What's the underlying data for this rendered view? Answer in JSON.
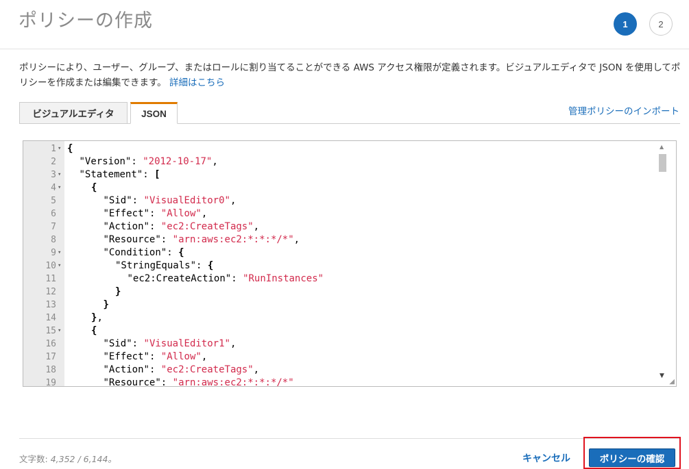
{
  "header": {
    "title": "ポリシーの作成",
    "steps": [
      "1",
      "2"
    ],
    "active_step": "1"
  },
  "description": {
    "text": "ポリシーにより、ユーザー、グループ、またはロールに割り当てることができる AWS アクセス権限が定義されます。ビジュアルエディタで JSON を使用してポリシーを作成または編集できます。",
    "link": "詳細はこちら"
  },
  "tabs": [
    {
      "label": "ビジュアルエディタ",
      "active": false
    },
    {
      "label": "JSON",
      "active": true
    }
  ],
  "import_link": "管理ポリシーのインポート",
  "editor": {
    "lines": [
      {
        "n": "1",
        "fold": true,
        "indent": 0,
        "parts": [
          [
            "p",
            "{"
          ]
        ]
      },
      {
        "n": "2",
        "fold": false,
        "indent": 1,
        "parts": [
          [
            "k",
            "\"Version\""
          ],
          [
            "k",
            ": "
          ],
          [
            "s",
            "\"2012-10-17\""
          ],
          [
            "k",
            ","
          ]
        ]
      },
      {
        "n": "3",
        "fold": true,
        "indent": 1,
        "parts": [
          [
            "k",
            "\"Statement\""
          ],
          [
            "k",
            ": "
          ],
          [
            "p",
            "["
          ]
        ]
      },
      {
        "n": "4",
        "fold": true,
        "indent": 2,
        "parts": [
          [
            "p",
            "{"
          ]
        ]
      },
      {
        "n": "5",
        "fold": false,
        "indent": 3,
        "parts": [
          [
            "k",
            "\"Sid\""
          ],
          [
            "k",
            ": "
          ],
          [
            "s",
            "\"VisualEditor0\""
          ],
          [
            "k",
            ","
          ]
        ]
      },
      {
        "n": "6",
        "fold": false,
        "indent": 3,
        "parts": [
          [
            "k",
            "\"Effect\""
          ],
          [
            "k",
            ": "
          ],
          [
            "s",
            "\"Allow\""
          ],
          [
            "k",
            ","
          ]
        ]
      },
      {
        "n": "7",
        "fold": false,
        "indent": 3,
        "parts": [
          [
            "k",
            "\"Action\""
          ],
          [
            "k",
            ": "
          ],
          [
            "s",
            "\"ec2:CreateTags\""
          ],
          [
            "k",
            ","
          ]
        ]
      },
      {
        "n": "8",
        "fold": false,
        "indent": 3,
        "parts": [
          [
            "k",
            "\"Resource\""
          ],
          [
            "k",
            ": "
          ],
          [
            "s",
            "\"arn:aws:ec2:*:*:*/*\""
          ],
          [
            "k",
            ","
          ]
        ]
      },
      {
        "n": "9",
        "fold": true,
        "indent": 3,
        "parts": [
          [
            "k",
            "\"Condition\""
          ],
          [
            "k",
            ": "
          ],
          [
            "p",
            "{"
          ]
        ]
      },
      {
        "n": "10",
        "fold": true,
        "indent": 4,
        "parts": [
          [
            "k",
            "\"StringEquals\""
          ],
          [
            "k",
            ": "
          ],
          [
            "p",
            "{"
          ]
        ]
      },
      {
        "n": "11",
        "fold": false,
        "indent": 5,
        "parts": [
          [
            "k",
            "\"ec2:CreateAction\""
          ],
          [
            "k",
            ": "
          ],
          [
            "s",
            "\"RunInstances\""
          ]
        ]
      },
      {
        "n": "12",
        "fold": false,
        "indent": 4,
        "parts": [
          [
            "p",
            "}"
          ]
        ]
      },
      {
        "n": "13",
        "fold": false,
        "indent": 3,
        "parts": [
          [
            "p",
            "}"
          ]
        ]
      },
      {
        "n": "14",
        "fold": false,
        "indent": 2,
        "parts": [
          [
            "p",
            "}"
          ],
          [
            "k",
            ","
          ]
        ]
      },
      {
        "n": "15",
        "fold": true,
        "indent": 2,
        "parts": [
          [
            "p",
            "{"
          ]
        ]
      },
      {
        "n": "16",
        "fold": false,
        "indent": 3,
        "parts": [
          [
            "k",
            "\"Sid\""
          ],
          [
            "k",
            ": "
          ],
          [
            "s",
            "\"VisualEditor1\""
          ],
          [
            "k",
            ","
          ]
        ]
      },
      {
        "n": "17",
        "fold": false,
        "indent": 3,
        "parts": [
          [
            "k",
            "\"Effect\""
          ],
          [
            "k",
            ": "
          ],
          [
            "s",
            "\"Allow\""
          ],
          [
            "k",
            ","
          ]
        ]
      },
      {
        "n": "18",
        "fold": false,
        "indent": 3,
        "parts": [
          [
            "k",
            "\"Action\""
          ],
          [
            "k",
            ": "
          ],
          [
            "s",
            "\"ec2:CreateTags\""
          ],
          [
            "k",
            ","
          ]
        ]
      },
      {
        "n": "19",
        "fold": false,
        "indent": 3,
        "parts": [
          [
            "k",
            "\"Resource\""
          ],
          [
            "k",
            ": "
          ],
          [
            "s",
            "\"arn:aws:ec2:*:*:*/*\""
          ]
        ]
      }
    ]
  },
  "footer": {
    "char_count_label": "文字数:",
    "char_count_value": "4,352 / 6,144。",
    "cancel_label": "キャンセル",
    "confirm_label": "ポリシーの確認"
  },
  "colors": {
    "primary": "#1a6dba",
    "tab_accent": "#e07b00",
    "string": "#d22a4c",
    "highlight": "#e0121e"
  }
}
